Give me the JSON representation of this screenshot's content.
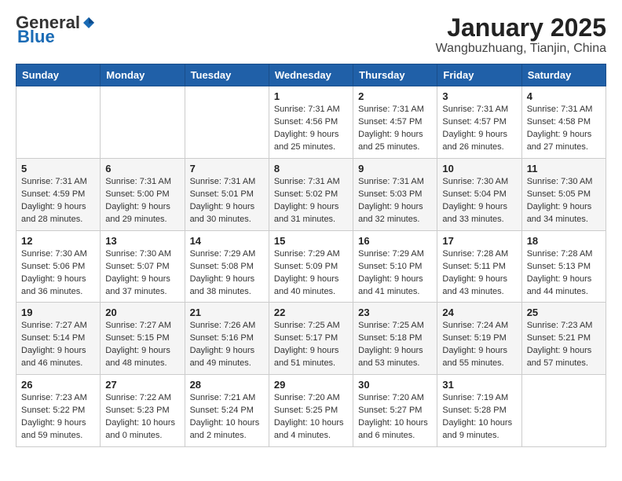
{
  "header": {
    "logo_general": "General",
    "logo_blue": "Blue",
    "calendar_title": "January 2025",
    "calendar_subtitle": "Wangbuzhuang, Tianjin, China"
  },
  "weekdays": [
    "Sunday",
    "Monday",
    "Tuesday",
    "Wednesday",
    "Thursday",
    "Friday",
    "Saturday"
  ],
  "weeks": [
    [
      {
        "day": "",
        "info": ""
      },
      {
        "day": "",
        "info": ""
      },
      {
        "day": "",
        "info": ""
      },
      {
        "day": "1",
        "info": "Sunrise: 7:31 AM\nSunset: 4:56 PM\nDaylight: 9 hours\nand 25 minutes."
      },
      {
        "day": "2",
        "info": "Sunrise: 7:31 AM\nSunset: 4:57 PM\nDaylight: 9 hours\nand 25 minutes."
      },
      {
        "day": "3",
        "info": "Sunrise: 7:31 AM\nSunset: 4:57 PM\nDaylight: 9 hours\nand 26 minutes."
      },
      {
        "day": "4",
        "info": "Sunrise: 7:31 AM\nSunset: 4:58 PM\nDaylight: 9 hours\nand 27 minutes."
      }
    ],
    [
      {
        "day": "5",
        "info": "Sunrise: 7:31 AM\nSunset: 4:59 PM\nDaylight: 9 hours\nand 28 minutes."
      },
      {
        "day": "6",
        "info": "Sunrise: 7:31 AM\nSunset: 5:00 PM\nDaylight: 9 hours\nand 29 minutes."
      },
      {
        "day": "7",
        "info": "Sunrise: 7:31 AM\nSunset: 5:01 PM\nDaylight: 9 hours\nand 30 minutes."
      },
      {
        "day": "8",
        "info": "Sunrise: 7:31 AM\nSunset: 5:02 PM\nDaylight: 9 hours\nand 31 minutes."
      },
      {
        "day": "9",
        "info": "Sunrise: 7:31 AM\nSunset: 5:03 PM\nDaylight: 9 hours\nand 32 minutes."
      },
      {
        "day": "10",
        "info": "Sunrise: 7:30 AM\nSunset: 5:04 PM\nDaylight: 9 hours\nand 33 minutes."
      },
      {
        "day": "11",
        "info": "Sunrise: 7:30 AM\nSunset: 5:05 PM\nDaylight: 9 hours\nand 34 minutes."
      }
    ],
    [
      {
        "day": "12",
        "info": "Sunrise: 7:30 AM\nSunset: 5:06 PM\nDaylight: 9 hours\nand 36 minutes."
      },
      {
        "day": "13",
        "info": "Sunrise: 7:30 AM\nSunset: 5:07 PM\nDaylight: 9 hours\nand 37 minutes."
      },
      {
        "day": "14",
        "info": "Sunrise: 7:29 AM\nSunset: 5:08 PM\nDaylight: 9 hours\nand 38 minutes."
      },
      {
        "day": "15",
        "info": "Sunrise: 7:29 AM\nSunset: 5:09 PM\nDaylight: 9 hours\nand 40 minutes."
      },
      {
        "day": "16",
        "info": "Sunrise: 7:29 AM\nSunset: 5:10 PM\nDaylight: 9 hours\nand 41 minutes."
      },
      {
        "day": "17",
        "info": "Sunrise: 7:28 AM\nSunset: 5:11 PM\nDaylight: 9 hours\nand 43 minutes."
      },
      {
        "day": "18",
        "info": "Sunrise: 7:28 AM\nSunset: 5:13 PM\nDaylight: 9 hours\nand 44 minutes."
      }
    ],
    [
      {
        "day": "19",
        "info": "Sunrise: 7:27 AM\nSunset: 5:14 PM\nDaylight: 9 hours\nand 46 minutes."
      },
      {
        "day": "20",
        "info": "Sunrise: 7:27 AM\nSunset: 5:15 PM\nDaylight: 9 hours\nand 48 minutes."
      },
      {
        "day": "21",
        "info": "Sunrise: 7:26 AM\nSunset: 5:16 PM\nDaylight: 9 hours\nand 49 minutes."
      },
      {
        "day": "22",
        "info": "Sunrise: 7:25 AM\nSunset: 5:17 PM\nDaylight: 9 hours\nand 51 minutes."
      },
      {
        "day": "23",
        "info": "Sunrise: 7:25 AM\nSunset: 5:18 PM\nDaylight: 9 hours\nand 53 minutes."
      },
      {
        "day": "24",
        "info": "Sunrise: 7:24 AM\nSunset: 5:19 PM\nDaylight: 9 hours\nand 55 minutes."
      },
      {
        "day": "25",
        "info": "Sunrise: 7:23 AM\nSunset: 5:21 PM\nDaylight: 9 hours\nand 57 minutes."
      }
    ],
    [
      {
        "day": "26",
        "info": "Sunrise: 7:23 AM\nSunset: 5:22 PM\nDaylight: 9 hours\nand 59 minutes."
      },
      {
        "day": "27",
        "info": "Sunrise: 7:22 AM\nSunset: 5:23 PM\nDaylight: 10 hours\nand 0 minutes."
      },
      {
        "day": "28",
        "info": "Sunrise: 7:21 AM\nSunset: 5:24 PM\nDaylight: 10 hours\nand 2 minutes."
      },
      {
        "day": "29",
        "info": "Sunrise: 7:20 AM\nSunset: 5:25 PM\nDaylight: 10 hours\nand 4 minutes."
      },
      {
        "day": "30",
        "info": "Sunrise: 7:20 AM\nSunset: 5:27 PM\nDaylight: 10 hours\nand 6 minutes."
      },
      {
        "day": "31",
        "info": "Sunrise: 7:19 AM\nSunset: 5:28 PM\nDaylight: 10 hours\nand 9 minutes."
      },
      {
        "day": "",
        "info": ""
      }
    ]
  ]
}
